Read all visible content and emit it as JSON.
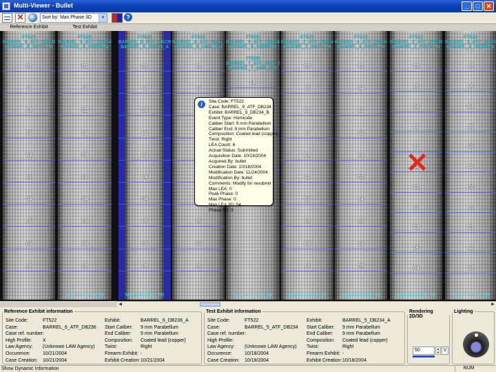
{
  "window": {
    "title": "Multi-Viewer - Bullet"
  },
  "toolbar": {
    "sort_value": "Sort by: Max Phase 3D",
    "icons": [
      "list-view-icon",
      "clear-icon",
      "globe-icon",
      "color-swap-icon",
      "help-icon"
    ]
  },
  "columns": {
    "reference_label": "Reference Exhibit",
    "test_label": "Test Exhibit"
  },
  "panels": [
    {
      "site": "FT522",
      "case": "BARREL_6_ATF_DB236",
      "exhibit": "BARREL_6_DB236_A",
      "score": "",
      "lands": [
        "G1",
        "L2",
        "G2",
        "L3",
        "G3",
        "L4",
        "G4",
        "L5",
        "G5",
        "L6"
      ]
    },
    {
      "site": "FT522",
      "case": "BARREL_5_ATF_DB234",
      "exhibit": "BARREL_5_DB234_A",
      "score": "Max Score 3D: 55",
      "lands": [
        "G1",
        "L2",
        "G2",
        "L3",
        "G3",
        "L4",
        "G4",
        "L5",
        "G5",
        "L6"
      ]
    },
    {
      "site": "FT522",
      "case": "BARREL_5_ATF_DB236",
      "exhibit": "BARREL_5_DB236_A",
      "score": "Max Score 3D: 55",
      "lands": [
        "G1",
        "L2",
        "G2",
        "L3",
        "G3",
        "L4",
        "G4",
        "L5",
        "G5",
        "L6"
      ]
    },
    {
      "site": "FT522",
      "case": "BARREL_8_ATF_UNK_234",
      "exhibit": "BARREL_8_UNK_234",
      "score": "",
      "lands": [
        "G1",
        "L1",
        "G2",
        "L3",
        "G3",
        "L4",
        "G4",
        "L5",
        "G5",
        "L6"
      ]
    },
    {
      "site": "FT522",
      "case": "BARREL_9_ATF_DB234",
      "exhibit": "BARREL_9_DB234_B",
      "score": "Max Score 3D: 54",
      "extra": [
        "FT522",
        "BARREL_7_ATF_UNK_236",
        "BARREL_7_UNK_236"
      ],
      "lands": [
        "L4",
        "L5",
        "G1"
      ]
    },
    {
      "site": "FT522",
      "case": "BARREL_2_ATF_DB234",
      "exhibit": "BARREL_2_DB234_B",
      "score": "Max Score 3D: 53",
      "lands": [
        "G5",
        "L6",
        "G6",
        "L1",
        "G1",
        "L2",
        "G2",
        "L3",
        "G3",
        "L4"
      ]
    },
    {
      "site": "FT522",
      "case": "BARREL_4_ATF_DB234",
      "exhibit": "BARREL_4_DB234_A",
      "score": "Max Score 3D: 53",
      "lands": [
        "L1",
        "G4",
        "L2",
        "G1",
        "L3",
        "G2",
        "L4",
        "G3",
        "L5",
        "G5"
      ]
    },
    {
      "site": "FT522",
      "case": "BARREL_2_ATF_DB236",
      "exhibit": "BARREL_2_DB236_A",
      "score": "Max Score 3D: 50",
      "lands": [
        "G5",
        "L6",
        "G6",
        "L1",
        "G1",
        "L2",
        "G2",
        "L3",
        "G3",
        "L4",
        "G4"
      ]
    },
    {
      "site": "FT522",
      "case": "BARREL_3_ATF_DB236",
      "exhibit": "BARREL_3_DB236_A",
      "score": "Max Score 3D: 50",
      "lands": [
        "L3",
        "L4",
        "G4",
        "L5",
        "G5",
        "L6",
        "G6",
        "L1",
        "G1",
        "L2",
        "G2"
      ]
    }
  ],
  "tooltip": {
    "lines": [
      "Site Code: FT522",
      "Case: BARREL_9_ATF_DB234",
      "Exhibit: BARREL_9_DB234_B",
      "Event Type: Homicide",
      "Caliber Start: 9 mm Parabellum",
      "Caliber End: 9 mm Parabellum",
      "Composition: Coated lead (copper)",
      "Twist: Right",
      "LEA Count: 6",
      "Actual Status: Submitted",
      "Acquisition Date: 10/18/2004",
      "Acquired By: bullet",
      "Creation Date: 10/18/2004",
      "Modification Date: 11/24/2004",
      "Modification By: bullet",
      "Comments: Modify for resubmit",
      "Max LEA: 0",
      "Peak Phase: 0",
      "Max Phase: 0",
      "Max LEA 3D: 54",
      "Phase 3D: 3"
    ]
  },
  "reference_info": {
    "title": "Reference Exhibit information",
    "left": [
      [
        "Site Code:",
        "FT522"
      ],
      [
        "Case:",
        "BARREL_6_ATF_DB236"
      ],
      [
        "Case ref. number:",
        ""
      ],
      [
        "High Profile:",
        "X"
      ],
      [
        "Law Agency:",
        "(Unknown LAW Agency)"
      ],
      [
        "Occurence:",
        "10/21/2004"
      ],
      [
        "Case Creation:",
        "10/21/2004"
      ]
    ],
    "right": [
      [
        "Exhibit:",
        "BARREL_6_DB236_A"
      ],
      [
        "Start Caliber:",
        "9 mm Parabellum"
      ],
      [
        "End Caliber:",
        "9 mm Parabellum"
      ],
      [
        "Composition:",
        "Coated lead (copper)"
      ],
      [
        "Twist:",
        "Right"
      ],
      [
        "Firearm Exhibit:",
        "-"
      ],
      [
        "Exhibit Creation:",
        "10/21/2004"
      ]
    ]
  },
  "test_info": {
    "title": "Test Exhibit information",
    "left": [
      [
        "Site Code:",
        "FT522"
      ],
      [
        "Case:",
        "BARREL_5_ATF_DB234"
      ],
      [
        "Case ref. number:",
        ""
      ],
      [
        "High Profile:",
        ""
      ],
      [
        "Law Agency:",
        "(Unknown LAW Agency)"
      ],
      [
        "Occurence:",
        "10/18/2004"
      ],
      [
        "Case Creation:",
        "10/18/2004"
      ]
    ],
    "right": [
      [
        "Exhibit:",
        "BARREL_5_DB234_A"
      ],
      [
        "Start Caliber:",
        "9 mm Parabellum"
      ],
      [
        "End Caliber:",
        "9 mm Parabellum"
      ],
      [
        "Composition:",
        "Coated lead (copper)"
      ],
      [
        "Twist:",
        "Right"
      ],
      [
        "Firearm Exhibit:",
        "-"
      ],
      [
        "Exhibit Creation:",
        "10/18/2004"
      ]
    ]
  },
  "rendering": {
    "title": "Rendering 2D/3D",
    "value": "50",
    "mode": "V"
  },
  "lighting": {
    "title": "Lighting"
  },
  "status": {
    "message": "Show Dynamic Information",
    "num": "NUM"
  },
  "colors": {
    "accent": "#31e8ff",
    "selection": "#2a2aa8",
    "reject": "#e12b1e"
  }
}
